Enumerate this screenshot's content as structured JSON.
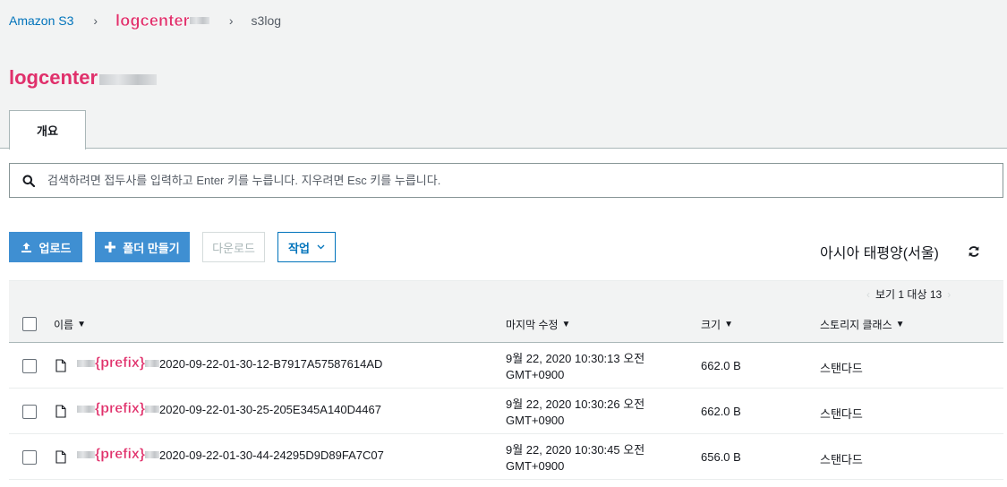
{
  "breadcrumb": {
    "root": "Amazon S3",
    "bucket": "logcenter",
    "folder": "s3log"
  },
  "page_title": "logcenter",
  "tabs": [
    {
      "label": "개요"
    }
  ],
  "search": {
    "placeholder": "검색하려면 접두사를 입력하고 Enter 키를 누릅니다. 지우려면 Esc 키를 누릅니다."
  },
  "toolbar": {
    "upload": "업로드",
    "create_folder": "폴더 만들기",
    "download": "다운로드",
    "actions": "작업"
  },
  "region": "아시아 태평양(서울)",
  "pager": {
    "text": "보기 1 대상 13",
    "prev": "‹",
    "next": "›"
  },
  "table": {
    "columns": {
      "name": "이름",
      "modified": "마지막 수정",
      "size": "크기",
      "storage": "스토리지 클래스"
    },
    "rows": [
      {
        "prefix": "{prefix}",
        "name": "2020-09-22-01-30-12-B7917A57587614AD",
        "modified_line1": "9월 22, 2020 10:30:13 오전",
        "modified_line2": "GMT+0900",
        "size": "662.0 B",
        "storage": "스탠다드"
      },
      {
        "prefix": "{prefix}",
        "name": "2020-09-22-01-30-25-205E345A140D4467",
        "modified_line1": "9월 22, 2020 10:30:26 오전",
        "modified_line2": "GMT+0900",
        "size": "662.0 B",
        "storage": "스탠다드"
      },
      {
        "prefix": "{prefix}",
        "name": "2020-09-22-01-30-44-24295D9D89FA7C07",
        "modified_line1": "9월 22, 2020 10:30:45 오전",
        "modified_line2": "GMT+0900",
        "size": "656.0 B",
        "storage": "스탠다드"
      }
    ]
  },
  "colors": {
    "link": "#0073bb",
    "primary_button": "#3f8fd2",
    "annotation": "#e0306b",
    "header_bg": "#f2f3f3"
  }
}
